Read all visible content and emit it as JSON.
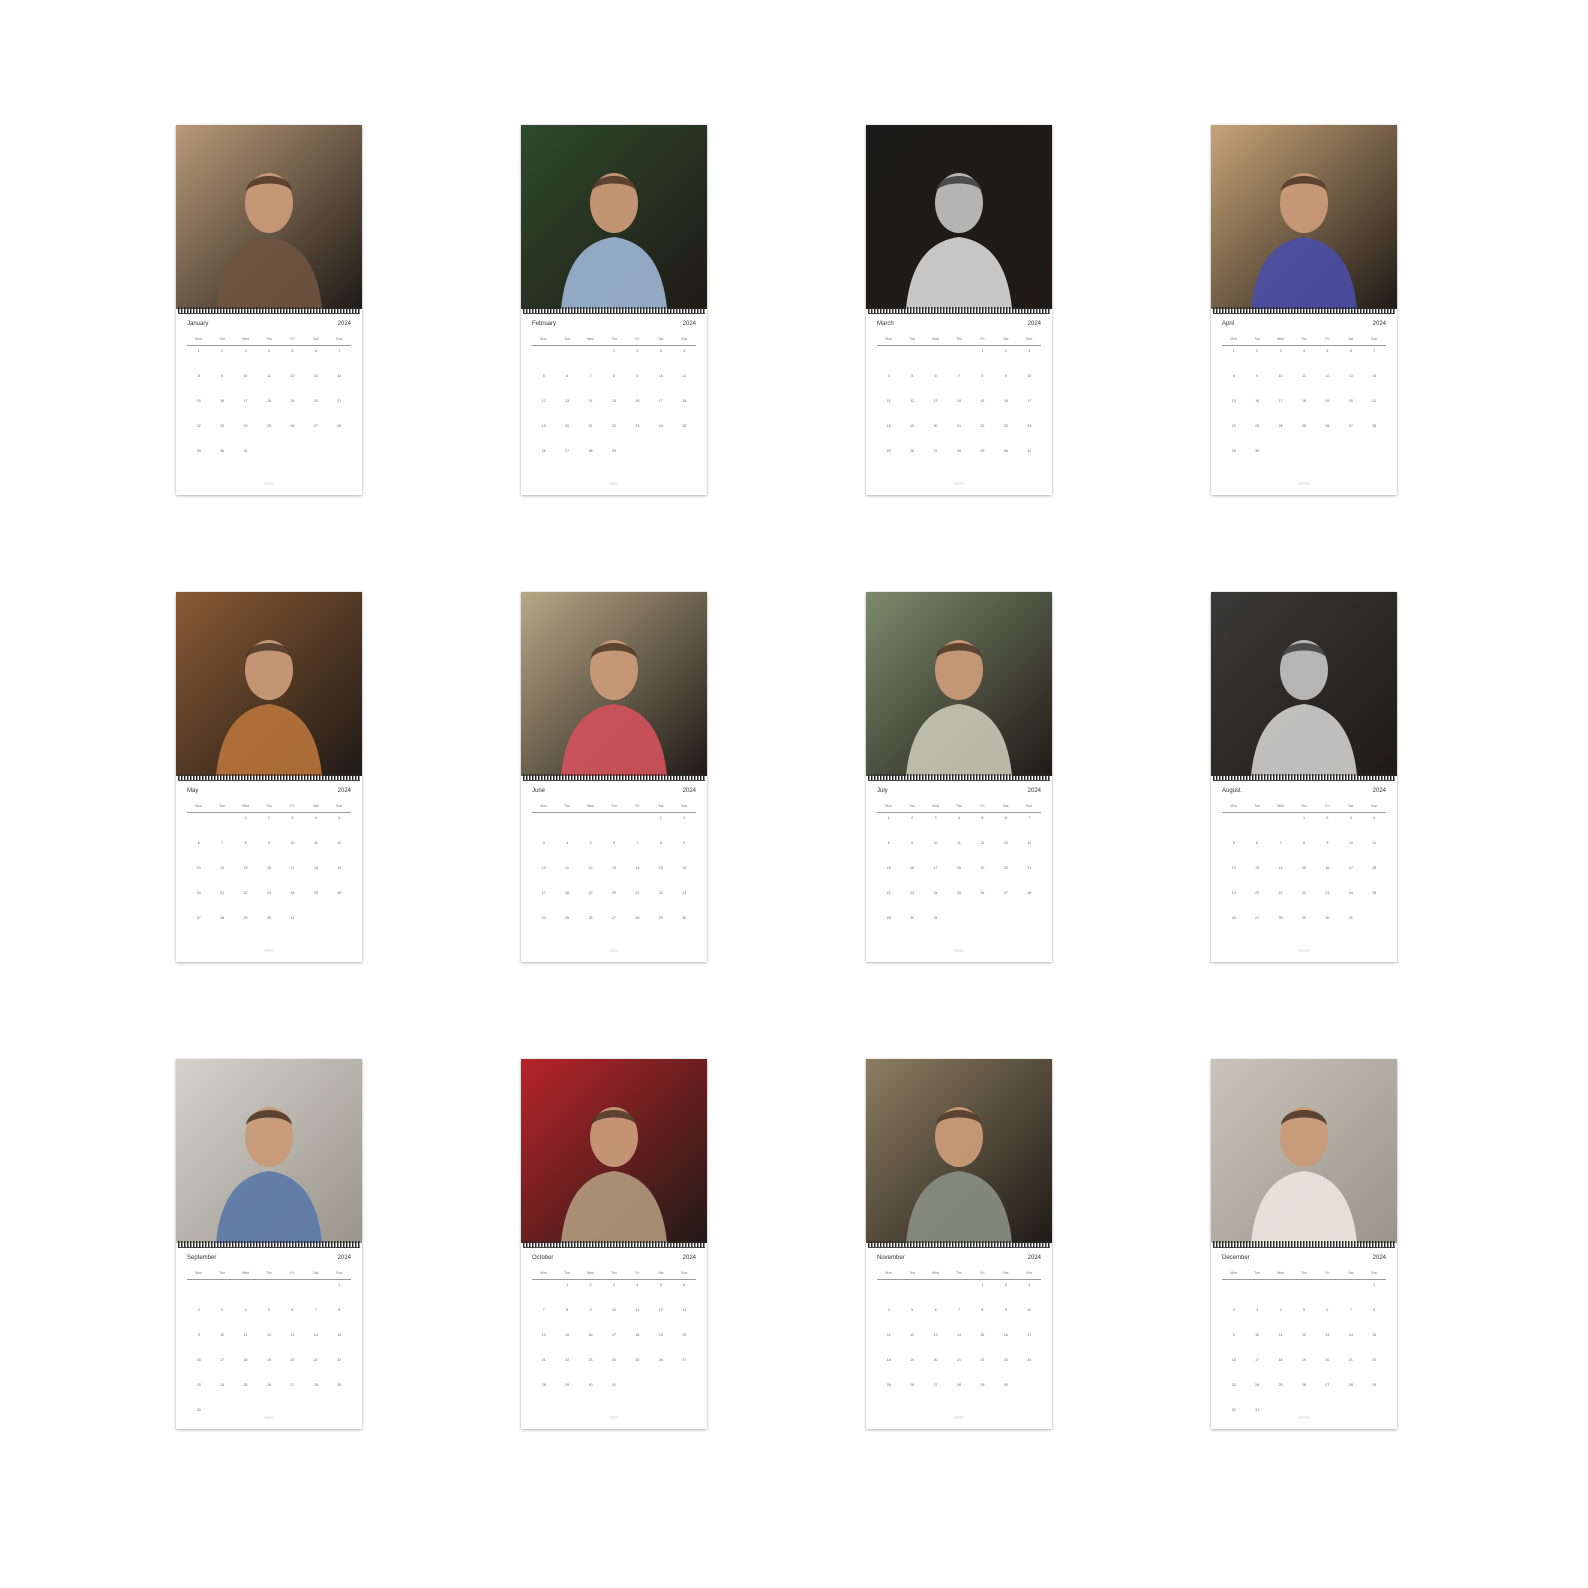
{
  "calendar": {
    "year": "2024",
    "weekdays": [
      "Mon",
      "Tue",
      "Wed",
      "Thu",
      "Fri",
      "Sat",
      "Sun"
    ],
    "months": [
      {
        "name": "January",
        "first_weekday": 0,
        "days": 31,
        "photo": {
          "bg": "#b89a78",
          "accent": "#6e5440",
          "tone": "warm"
        }
      },
      {
        "name": "February",
        "first_weekday": 3,
        "days": 29,
        "photo": {
          "bg": "#2f4a2c",
          "accent": "#9fb7d6",
          "tone": "green"
        }
      },
      {
        "name": "March",
        "first_weekday": 4,
        "days": 31,
        "photo": {
          "bg": "#1c1c1c",
          "accent": "#d9d9d9",
          "tone": "mono"
        }
      },
      {
        "name": "April",
        "first_weekday": 0,
        "days": 30,
        "photo": {
          "bg": "#c7a477",
          "accent": "#4a4ea6",
          "tone": "warm"
        }
      },
      {
        "name": "May",
        "first_weekday": 2,
        "days": 31,
        "photo": {
          "bg": "#8a5a34",
          "accent": "#b8743c",
          "tone": "warm"
        }
      },
      {
        "name": "June",
        "first_weekday": 5,
        "days": 30,
        "photo": {
          "bg": "#b7a886",
          "accent": "#d3525c",
          "tone": "warm"
        }
      },
      {
        "name": "July",
        "first_weekday": 0,
        "days": 31,
        "photo": {
          "bg": "#7d8a6c",
          "accent": "#c9c9b8",
          "tone": "green"
        }
      },
      {
        "name": "August",
        "first_weekday": 3,
        "days": 31,
        "photo": {
          "bg": "#3a3a3a",
          "accent": "#cfcfcf",
          "tone": "mono"
        }
      },
      {
        "name": "September",
        "first_weekday": 6,
        "days": 30,
        "photo": {
          "bg": "#d4d2cc",
          "accent": "#5a78a8",
          "tone": "light"
        }
      },
      {
        "name": "October",
        "first_weekday": 1,
        "days": 31,
        "photo": {
          "bg": "#b8242a",
          "accent": "#b09a7c",
          "tone": "red"
        }
      },
      {
        "name": "November",
        "first_weekday": 4,
        "days": 30,
        "photo": {
          "bg": "#8c7e62",
          "accent": "#8a8f84",
          "tone": "warm"
        }
      },
      {
        "name": "December",
        "first_weekday": 6,
        "days": 31,
        "photo": {
          "bg": "#c9c4ba",
          "accent": "#ebe7df",
          "tone": "light"
        }
      }
    ]
  }
}
